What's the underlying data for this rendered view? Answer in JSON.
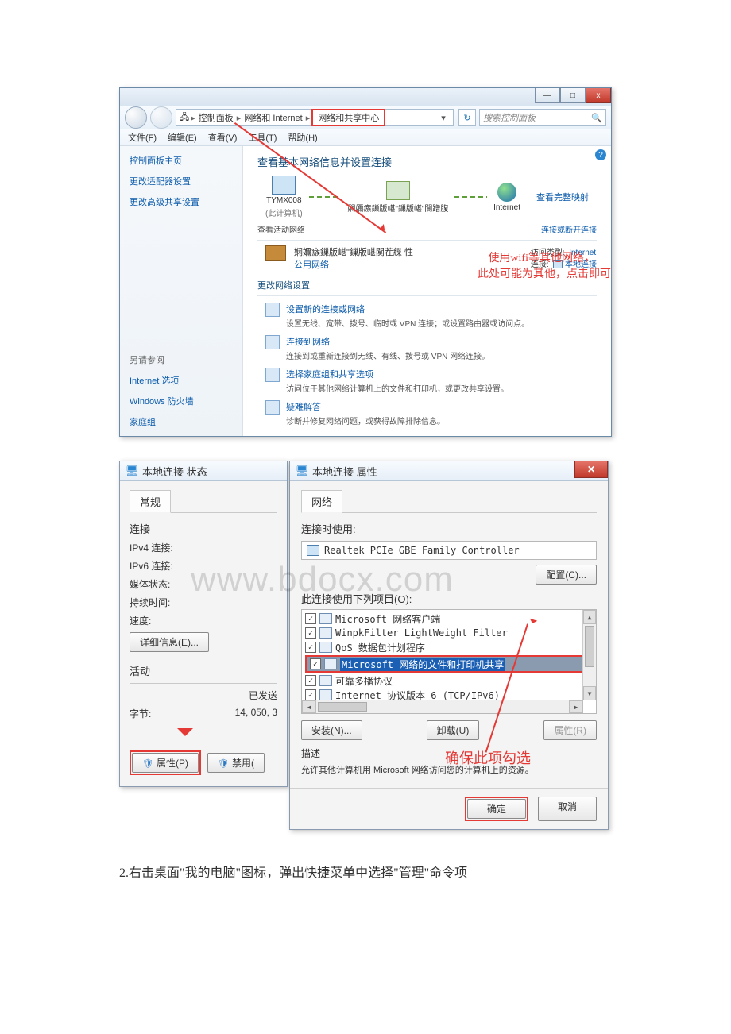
{
  "watermark": "www.bdocx.com",
  "caption": "2.右击桌面\"我的电脑\"图标，弹出快捷菜单中选择\"管理\"命令项",
  "nsc": {
    "titlebar": {
      "min": "—",
      "max": "□",
      "close": "x"
    },
    "breadcrumb": {
      "sep": "▸",
      "c1": "控制面板",
      "c2": "网络和 Internet",
      "c3": "网络和共享中心"
    },
    "refresh_icon": "↻",
    "search": {
      "placeholder": "搜索控制面板",
      "icon": "🔍"
    },
    "menu": {
      "file": "文件(F)",
      "edit": "编辑(E)",
      "view": "查看(V)",
      "tools": "工具(T)",
      "help": "帮助(H)"
    },
    "help_icon": "?",
    "sidebar": {
      "home": "控制面板主页",
      "adapter": "更改适配器设置",
      "advshare": "更改高级共享设置",
      "seealso": "另请参阅",
      "inetopt": "Internet 选项",
      "firewall": "Windows 防火墙",
      "homegroup": "家庭组"
    },
    "main": {
      "heading": "查看基本网络信息并设置连接",
      "fullmap": "查看完整映射",
      "pc": "TYMX008",
      "pc_sub": "(此计算机)",
      "middle": "娴嬭瘯鏁版嵁\"鏁版嵁\"闃蹭腹",
      "internet": "Internet",
      "active_label": "查看活动网络",
      "condisc": "连接或断开连接",
      "netname": "娴嬭瘯鏁版嵁\"鏁版嵁闃茬緤    性",
      "nettype": "公用网络",
      "accesstype_l": "访问类型:",
      "accesstype_v": "Internet",
      "conn_l": "连接:",
      "conn_v": "本地连接",
      "change_label": "更改网络设置",
      "i1t": "设置新的连接或网络",
      "i1d": "设置无线、宽带、拨号、临时或 VPN 连接；或设置路由器或访问点。",
      "i2t": "连接到网络",
      "i2d": "连接到或重新连接到无线、有线、拨号或 VPN 网络连接。",
      "i3t": "选择家庭组和共享选项",
      "i3d": "访问位于其他网络计算机上的文件和打印机，或更改共享设置。",
      "i4t": "疑难解答",
      "i4d": "诊断并修复网络问题，或获得故障排除信息。",
      "anno1": "使用wifi等其他网络，",
      "anno2": "此处可能为其他，点击即可"
    }
  },
  "status": {
    "title": "本地连接 状态",
    "tab": "常规",
    "conn_h": "连接",
    "ipv4": "IPv4 连接:",
    "ipv6": "IPv6 连接:",
    "media": "媒体状态:",
    "duration": "持续时间:",
    "speed": "速度:",
    "details": "详细信息(E)...",
    "activity": "活动",
    "sent": "已发送",
    "bytes_l": "字节:",
    "bytes_v": "14, 050, 3",
    "props": "属性(P)",
    "disable": "禁用("
  },
  "prop": {
    "title": "本地连接 属性",
    "tab": "网络",
    "connect_using": "连接时使用:",
    "adapter": "Realtek PCIe GBE Family Controller",
    "configure": "配置(C)...",
    "uses": "此连接使用下列项目(O):",
    "items": [
      {
        "chk": true,
        "label": "Microsoft 网络客户端"
      },
      {
        "chk": true,
        "label": "WinpkFilter LightWeight Filter"
      },
      {
        "chk": true,
        "label": "QoS 数据包计划程序"
      },
      {
        "chk": true,
        "label": "Microsoft 网络的文件和打印机共享",
        "sel": true
      },
      {
        "chk": true,
        "label": "可靠多播协议"
      },
      {
        "chk": true,
        "label": "Internet 协议版本 6 (TCP/IPv6)"
      }
    ],
    "install": "安装(N)...",
    "uninstall": "卸载(U)",
    "propbtn": "属性(R)",
    "desc_h": "描述",
    "desc": "允许其他计算机用 Microsoft 网络访问您的计算机上的资源。",
    "anno": "确保此项勾选",
    "ok": "确定",
    "cancel": "取消"
  }
}
